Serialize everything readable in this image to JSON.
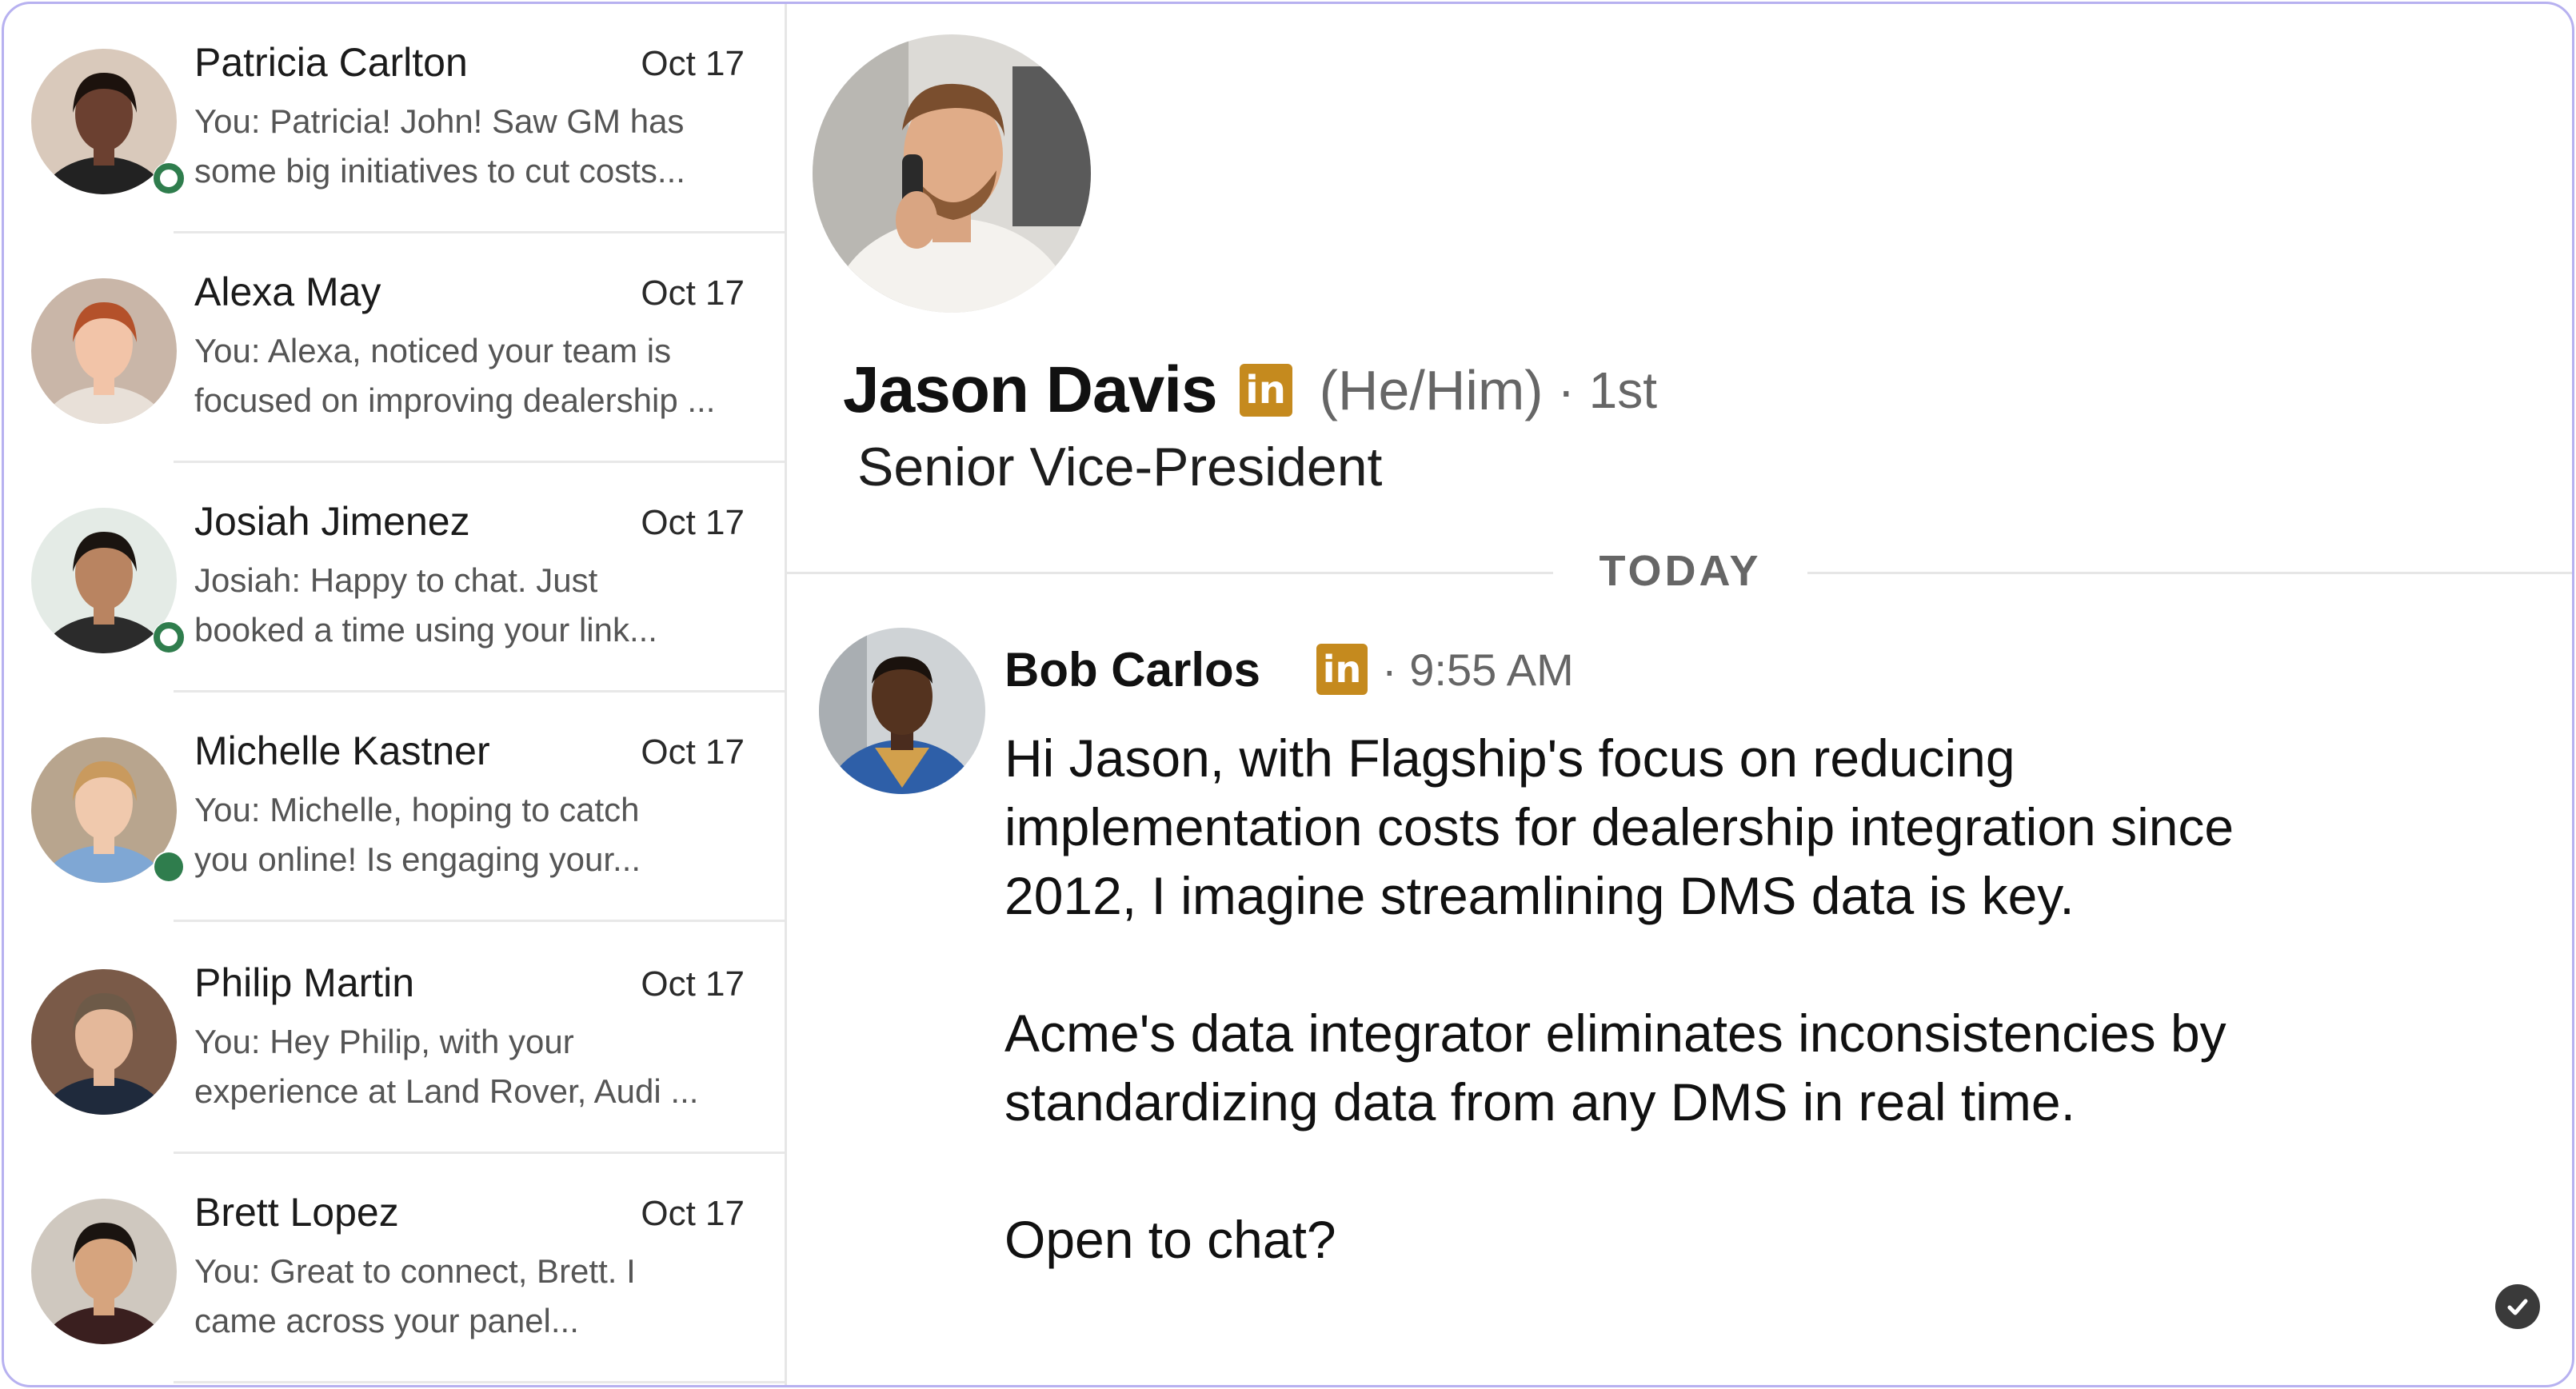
{
  "conversations": [
    {
      "name": "Patricia Carlton",
      "date": "Oct 17",
      "preview_line1": "You: Patricia! John! Saw GM has",
      "preview_line2": "some big initiatives to cut costs...",
      "presence": "ring",
      "skin": "#6b4030",
      "hair": "#1c120d",
      "bg": "#d9c9bb",
      "shirt": "#222222"
    },
    {
      "name": "Alexa May",
      "date": "Oct 17",
      "preview_line1": "You: Alexa, noticed your team is",
      "preview_line2": "focused on improving dealership ...",
      "presence": "none",
      "skin": "#f2c4a8",
      "hair": "#b4512a",
      "bg": "#c9b6a8",
      "shirt": "#e8e0d8"
    },
    {
      "name": "Josiah Jimenez",
      "date": "Oct 17",
      "preview_line1": "Josiah: Happy to chat. Just",
      "preview_line2": "booked a time using your link...",
      "presence": "ring",
      "skin": "#b98461",
      "hair": "#1a1410",
      "bg": "#e4ebe6",
      "shirt": "#2b2b2b"
    },
    {
      "name": "Michelle Kastner",
      "date": "Oct 17",
      "preview_line1": "You: Michelle, hoping to catch",
      "preview_line2": "you online! Is engaging your...",
      "presence": "solid",
      "skin": "#f0c9ad",
      "hair": "#c99a5e",
      "bg": "#b8a58e",
      "shirt": "#7fa7d4"
    },
    {
      "name": "Philip Martin",
      "date": "Oct 17",
      "preview_line1": "You: Hey Philip, with your",
      "preview_line2": "experience at Land Rover, Audi ...",
      "presence": "none",
      "skin": "#e4b89a",
      "hair": "#6d5a48",
      "bg": "#7a5a48",
      "shirt": "#1f2a3c"
    },
    {
      "name": "Brett Lopez",
      "date": "Oct 17",
      "preview_line1": "You: Great to connect, Brett. I",
      "preview_line2": "came across your panel...",
      "presence": "none",
      "skin": "#d6a47e",
      "hair": "#1a1410",
      "bg": "#cfc8bf",
      "shirt": "#3a1f1f"
    }
  ],
  "profile": {
    "name": "Jason Davis",
    "badge": "in",
    "pronouns": "(He/Him)",
    "degree": "· 1st",
    "title": "Senior Vice-President"
  },
  "thread": {
    "day_label": "TODAY",
    "sender": "Bob Carlos",
    "badge": "in",
    "time": "· 9:55 AM",
    "paragraphs": [
      "Hi Jason, with Flagship's focus on reducing implementation costs for dealership integration since 2012, I imagine streamlining DMS data is key.",
      "Acme's data integrator eliminates inconsistencies by standardizing data from any DMS in real time.",
      "Open to chat?"
    ],
    "status_icon": "read-check-icon"
  },
  "colors": {
    "frame_border": "#b7b1f0",
    "presence_green": "#2f7d4d",
    "linkedin_badge": "#c58a1e"
  }
}
